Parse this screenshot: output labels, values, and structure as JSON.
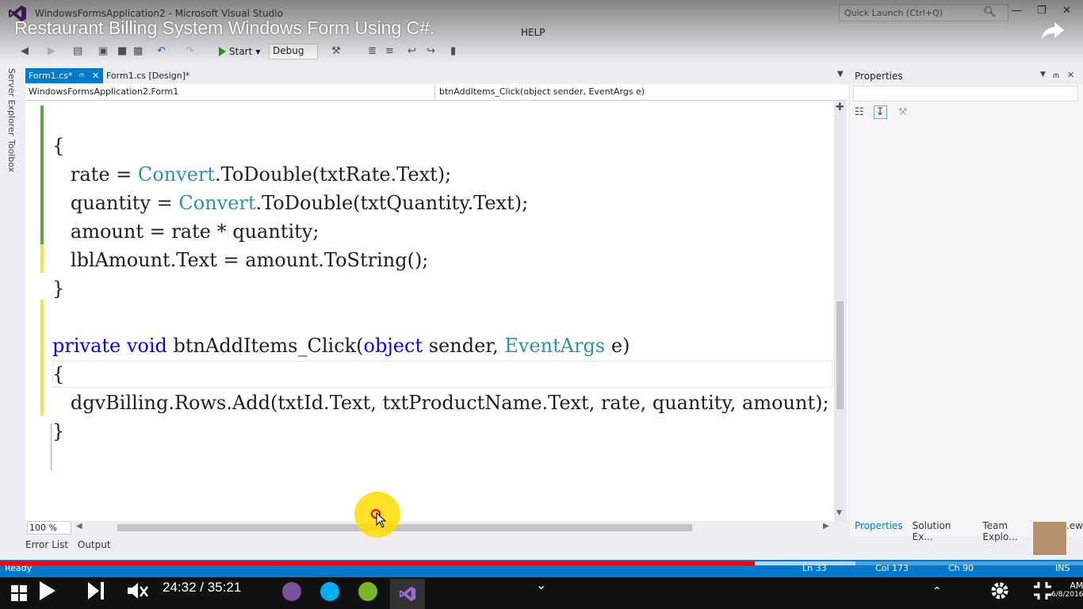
{
  "window": {
    "title": "WindowsFormsApplication2 - Microsoft Visual Studio",
    "quick_launch_placeholder": "Quick Launch (Ctrl+Q)"
  },
  "video": {
    "title": "Restaurant Billing System Windows Form Using C#.",
    "time": "24:32 / 35:21",
    "progress": 0.697,
    "buffered": 0.79
  },
  "menu": {
    "help": "HELP"
  },
  "toolbar": {
    "start": "Start",
    "config": "Debug"
  },
  "left_tabs": {
    "server_explorer": "Server Explorer",
    "toolbox": "Toolbox"
  },
  "doc_tabs": [
    {
      "label": "Form1.cs*",
      "active": true
    },
    {
      "label": "Form1.cs [Design]*",
      "active": false
    }
  ],
  "navbar": {
    "class": "WindowsFormsApplication2.Form1",
    "method": "btnAddItems_Click(object sender, EventArgs e)"
  },
  "code": {
    "l1": "{",
    "l2a": "   rate = ",
    "l2b": "Convert",
    "l2c": ".ToDouble(txtRate.Text);",
    "l3a": "   quantity = ",
    "l3b": "Convert",
    "l3c": ".ToDouble(txtQuantity.Text);",
    "l4": "   amount = rate * quantity;",
    "l5": "   lblAmount.Text = amount.ToString();",
    "l6": "}",
    "l8a": "private",
    "l8b": " ",
    "l8c": "void",
    "l8d": " btnAddItems_Click(",
    "l8e": "object",
    "l8f": " sender, ",
    "l8g": "EventArgs",
    "l8h": " e)",
    "l9": "{",
    "l10": "   dgvBilling.Rows.Add(txtId.Text, txtProductName.Text, rate, quantity, amount);",
    "l11": "}"
  },
  "editor": {
    "zoom": "100 %"
  },
  "bottom_tabs": [
    "Error List",
    "Output"
  ],
  "properties": {
    "title": "Properties",
    "tabs": [
      "Properties",
      "Solution Ex...",
      "Team Explo...",
      "C...ew"
    ]
  },
  "status": {
    "ready": "Ready",
    "ln": "Ln 33",
    "col": "Col 173",
    "ch": "Ch 90",
    "ins": "INS"
  },
  "clock": {
    "time": "AM",
    "date": "6/8/2016"
  },
  "colors": {
    "accent": "#007acc",
    "keyword": "#0000ff",
    "type": "#2b91af",
    "progress": "#ff0000"
  }
}
